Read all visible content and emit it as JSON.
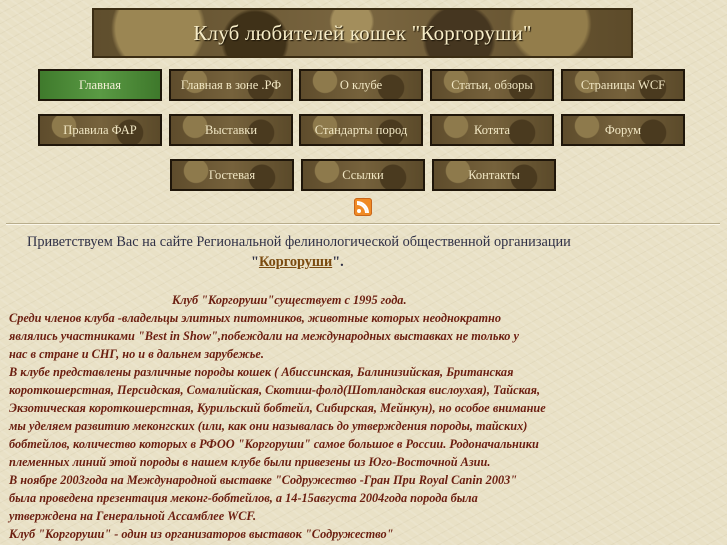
{
  "header": {
    "title": "Клуб любителей кошек \"Коргоруши\""
  },
  "nav": [
    {
      "label": "Главная",
      "active": true
    },
    {
      "label": "Главная в зоне .РФ"
    },
    {
      "label": "О клубе"
    },
    {
      "label": "Статьи, обзоры"
    },
    {
      "label": "Страницы WCF"
    },
    {
      "label": "Правила ФАР"
    },
    {
      "label": "Выставки"
    },
    {
      "label": "Стандарты пород"
    },
    {
      "label": "Котята"
    },
    {
      "label": "Форум"
    },
    {
      "label": "Гостевая"
    },
    {
      "label": "Ссылки"
    },
    {
      "label": "Контакты"
    }
  ],
  "icons": {
    "feed": "rss-icon"
  },
  "welcome": {
    "line1": "Приветствуем Вас на сайте Региональной фелинологической общественной  организации",
    "quote_open": "\"",
    "link": "Коргоруши",
    "quote_close": "\"."
  },
  "content": [
    "Клуб \"Коргоруши\"существует с 1995 года.",
    "Среди членов клуба  -владельцы элитных питомников, животные которых неоднократно",
    "являлись участниками  \"Best  in  Show\",побеждали на международных выставках не только у",
    " нас в стране и СНГ, но и в дальнем зарубежье.",
    "В клубе представлены различные породы кошек  (       Абиссинская, Балинизийская, Британская",
    "короткошерстная, Персидская, Сомалийская, Скотиш-фолд(Шотландская вислоухая), Тайская,",
    "Экзотическая короткошерстная, Курильский бобтейл, Сибирская, Мейнкун), но особое внимание",
    "мы уделяем развитию меконгских (или, как они называлась до утверждения породы, тайских)",
    "бобтейлов, количество которых в РФОО \"Коргоруши\" самое большое в России. Родоначальники",
    "племенных линий  этой породы в нашем клубе были привезены из Юго-Восточной  Азии.",
    "В ноябре  2003года на Международной выставке \"Содружество  -Гран При  Royal Canin  2003\"",
    "была проведена презентация меконг-бобтейлов, а    14-15августа    2004года порода была",
    "утверждена на Генеральной Ассамблее WCF.",
    "Клуб \"Коргоруши\" - один из организаторов выставок \"Содружество\""
  ]
}
